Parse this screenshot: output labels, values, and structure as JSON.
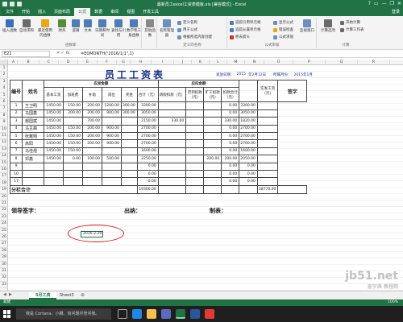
{
  "window": {
    "title": "最新员工excel工资表模板.xls [兼容模式] - Excel",
    "controls": [
      "?",
      "▭",
      "—",
      "❐",
      "✕"
    ]
  },
  "ribbon_tabs": [
    "文件",
    "开始",
    "插入",
    "页面布局",
    "公式",
    "数据",
    "审阅",
    "视图",
    "开发工具"
  ],
  "active_tab": "公式",
  "tell_me": "登录",
  "ribbon": {
    "insert_function": "插入函数",
    "autosum": "自动求和",
    "recent": "最近使用的函数",
    "financial": "财务",
    "logical": "逻辑",
    "text": "文本",
    "datetime": "日期和时间",
    "lookup": "查找与引用",
    "math": "数学和三角函数",
    "other": "其他函数",
    "name_manager": "名称管理器",
    "define_name": "定义名称",
    "use_in_formula": "用于公式",
    "create_from_sel": "根据所选内容创建",
    "trace_precedents": "追踪引用单元格",
    "trace_dependents": "追踪从属单元格",
    "remove_arrows": "移去箭头",
    "show_formulas": "显示公式",
    "error_checking": "错误检查",
    "evaluate": "公式求值",
    "watch": "监视窗口",
    "calc_options": "计算选项",
    "calc_now": "开始计算",
    "calc_sheet": "计算工作表",
    "group_library": "函数库",
    "group_names": "定义的名称",
    "group_audit": "公式审核",
    "group_calc": "计算"
  },
  "formula_bar": {
    "name_box": "E21",
    "formula": "=EOMONTH(\"2016/1/1\",1)"
  },
  "columns": [
    "A",
    "B",
    "C",
    "D",
    "E",
    "F",
    "G",
    "H",
    "I",
    "J",
    "K",
    "L",
    "M",
    "N",
    "O",
    "P",
    "Q",
    "R",
    "S"
  ],
  "rows": [
    "1",
    "2",
    "3",
    "4",
    "5",
    "6",
    "7",
    "8",
    "9",
    "10",
    "11",
    "12",
    "13",
    "14",
    "15",
    "16",
    "17",
    "18",
    "19",
    "20",
    "21",
    "22",
    "23",
    "24",
    "25",
    "26",
    "27",
    "28",
    "29",
    "30",
    "31",
    "32",
    "33"
  ],
  "sheet": {
    "title": "员工工资表",
    "date_label": "发放日期：",
    "date_year": "2015",
    "date_mid": "年2月12日",
    "period_label": "所属月份：",
    "period": "2015年1月",
    "head": {
      "no": "编号",
      "name": "姓名",
      "payable": "应发金额",
      "deduct": "应扣金额",
      "net": "实发工资(元)",
      "sign": "签字",
      "base": "基本工资",
      "overtime": "加班费",
      "allowance": "补助",
      "position": "岗位",
      "bonus": "奖金",
      "subtotal": "合计（元）",
      "leave": "请假扣款（元）",
      "late": "迟到扣款（元）",
      "absent": "旷工扣款（元）",
      "total_deduct": "扣款合计（元）"
    },
    "rows": [
      {
        "no": "1",
        "name": "王卫明",
        "base": "1450.00",
        "ot": "150.00",
        "allow": "200.00",
        "pos": "1200.00",
        "bonus": "300.00",
        "sub": "3300.00",
        "leave": "",
        "late": "",
        "absent": "",
        "td": "0.00",
        "net": "3300.00"
      },
      {
        "no": "2",
        "name": "马国鑫",
        "base": "1450.00",
        "ot": "200.00",
        "allow": "200.00",
        "pos": "900.00",
        "bonus": "300.00",
        "sub": "3050.00",
        "leave": "",
        "late": "",
        "absent": "",
        "td": "0.00",
        "net": "3050.00"
      },
      {
        "no": "3",
        "name": "郝国斌",
        "base": "1450.00",
        "ot": "",
        "allow": "700.00",
        "pos": "",
        "bonus": "",
        "sub": "2150.00",
        "leave": "330.00",
        "late": "",
        "absent": "",
        "td": "330.00",
        "net": "1820.00"
      },
      {
        "no": "4",
        "name": "马主裔",
        "base": "1450.00",
        "ot": "150.00",
        "allow": "200.00",
        "pos": "900.00",
        "bonus": "",
        "sub": "2700.00",
        "leave": "",
        "late": "",
        "absent": "",
        "td": "0.00",
        "net": "2700.00"
      },
      {
        "no": "5",
        "name": "张翼翔",
        "base": "1450.00",
        "ot": "150.00",
        "allow": "200.00",
        "pos": "900.00",
        "bonus": "",
        "sub": "2700.00",
        "leave": "",
        "late": "",
        "absent": "",
        "td": "0.00",
        "net": "2700.00"
      },
      {
        "no": "6",
        "name": "高阳",
        "base": "1450.00",
        "ot": "150.00",
        "allow": "200.00",
        "pos": "900.00",
        "bonus": "",
        "sub": "2700.00",
        "leave": "",
        "late": "",
        "absent": "",
        "td": "0.00",
        "net": "2700.00"
      },
      {
        "no": "7",
        "name": "马佳煜",
        "base": "1450.00",
        "ot": "150.00",
        "allow": "",
        "pos": "",
        "bonus": "",
        "sub": "1600.00",
        "leave": "",
        "late": "",
        "absent": "",
        "td": "0.00",
        "net": "1600.00"
      },
      {
        "no": "8",
        "name": "邓鑫",
        "base": "1450.00",
        "ot": "0.00",
        "allow": "100.00",
        "pos": "500.00",
        "bonus": "",
        "sub": "2250.00",
        "leave": "",
        "late": "",
        "absent": "200.00",
        "td": "200.00",
        "net": "2050.00"
      },
      {
        "no": "9",
        "name": "",
        "base": "",
        "ot": "",
        "allow": "",
        "pos": "",
        "bonus": "",
        "sub": "0.00",
        "leave": "",
        "late": "",
        "absent": "",
        "td": "0.00",
        "net": "0.00"
      },
      {
        "no": "10",
        "name": "",
        "base": "",
        "ot": "",
        "allow": "",
        "pos": "",
        "bonus": "",
        "sub": "0.00",
        "leave": "",
        "late": "",
        "absent": "",
        "td": "0.00",
        "net": "0.00"
      },
      {
        "no": "17",
        "name": "",
        "base": "",
        "ot": "",
        "allow": "",
        "pos": "",
        "bonus": "",
        "sub": "0.00",
        "leave": "",
        "late": "",
        "absent": "",
        "td": "0.00",
        "net": "0.00"
      }
    ],
    "total_label": "分栏合计",
    "total_sub": "19300.00",
    "total_net": "18770.00",
    "sig_leader": "领导签字：",
    "sig_cashier": "出纳：",
    "sig_maker": "制表："
  },
  "active_cell_value": "2016-2-29",
  "sheet_tabs": [
    "5月工资",
    "Sheet3"
  ],
  "active_sheet": "5月工资",
  "status": {
    "left": "就绪",
    "zoom": "100%"
  },
  "taskbar": {
    "search_placeholder": "我是 Cortana，小娜。有问题尽管问我。"
  },
  "watermark": {
    "line1": "jb51.net",
    "line2": "查字典 教程网"
  },
  "colors": {
    "excel_green": "#217346",
    "title_blue": "#1a2f8a",
    "highlight_red": "#d71920"
  }
}
